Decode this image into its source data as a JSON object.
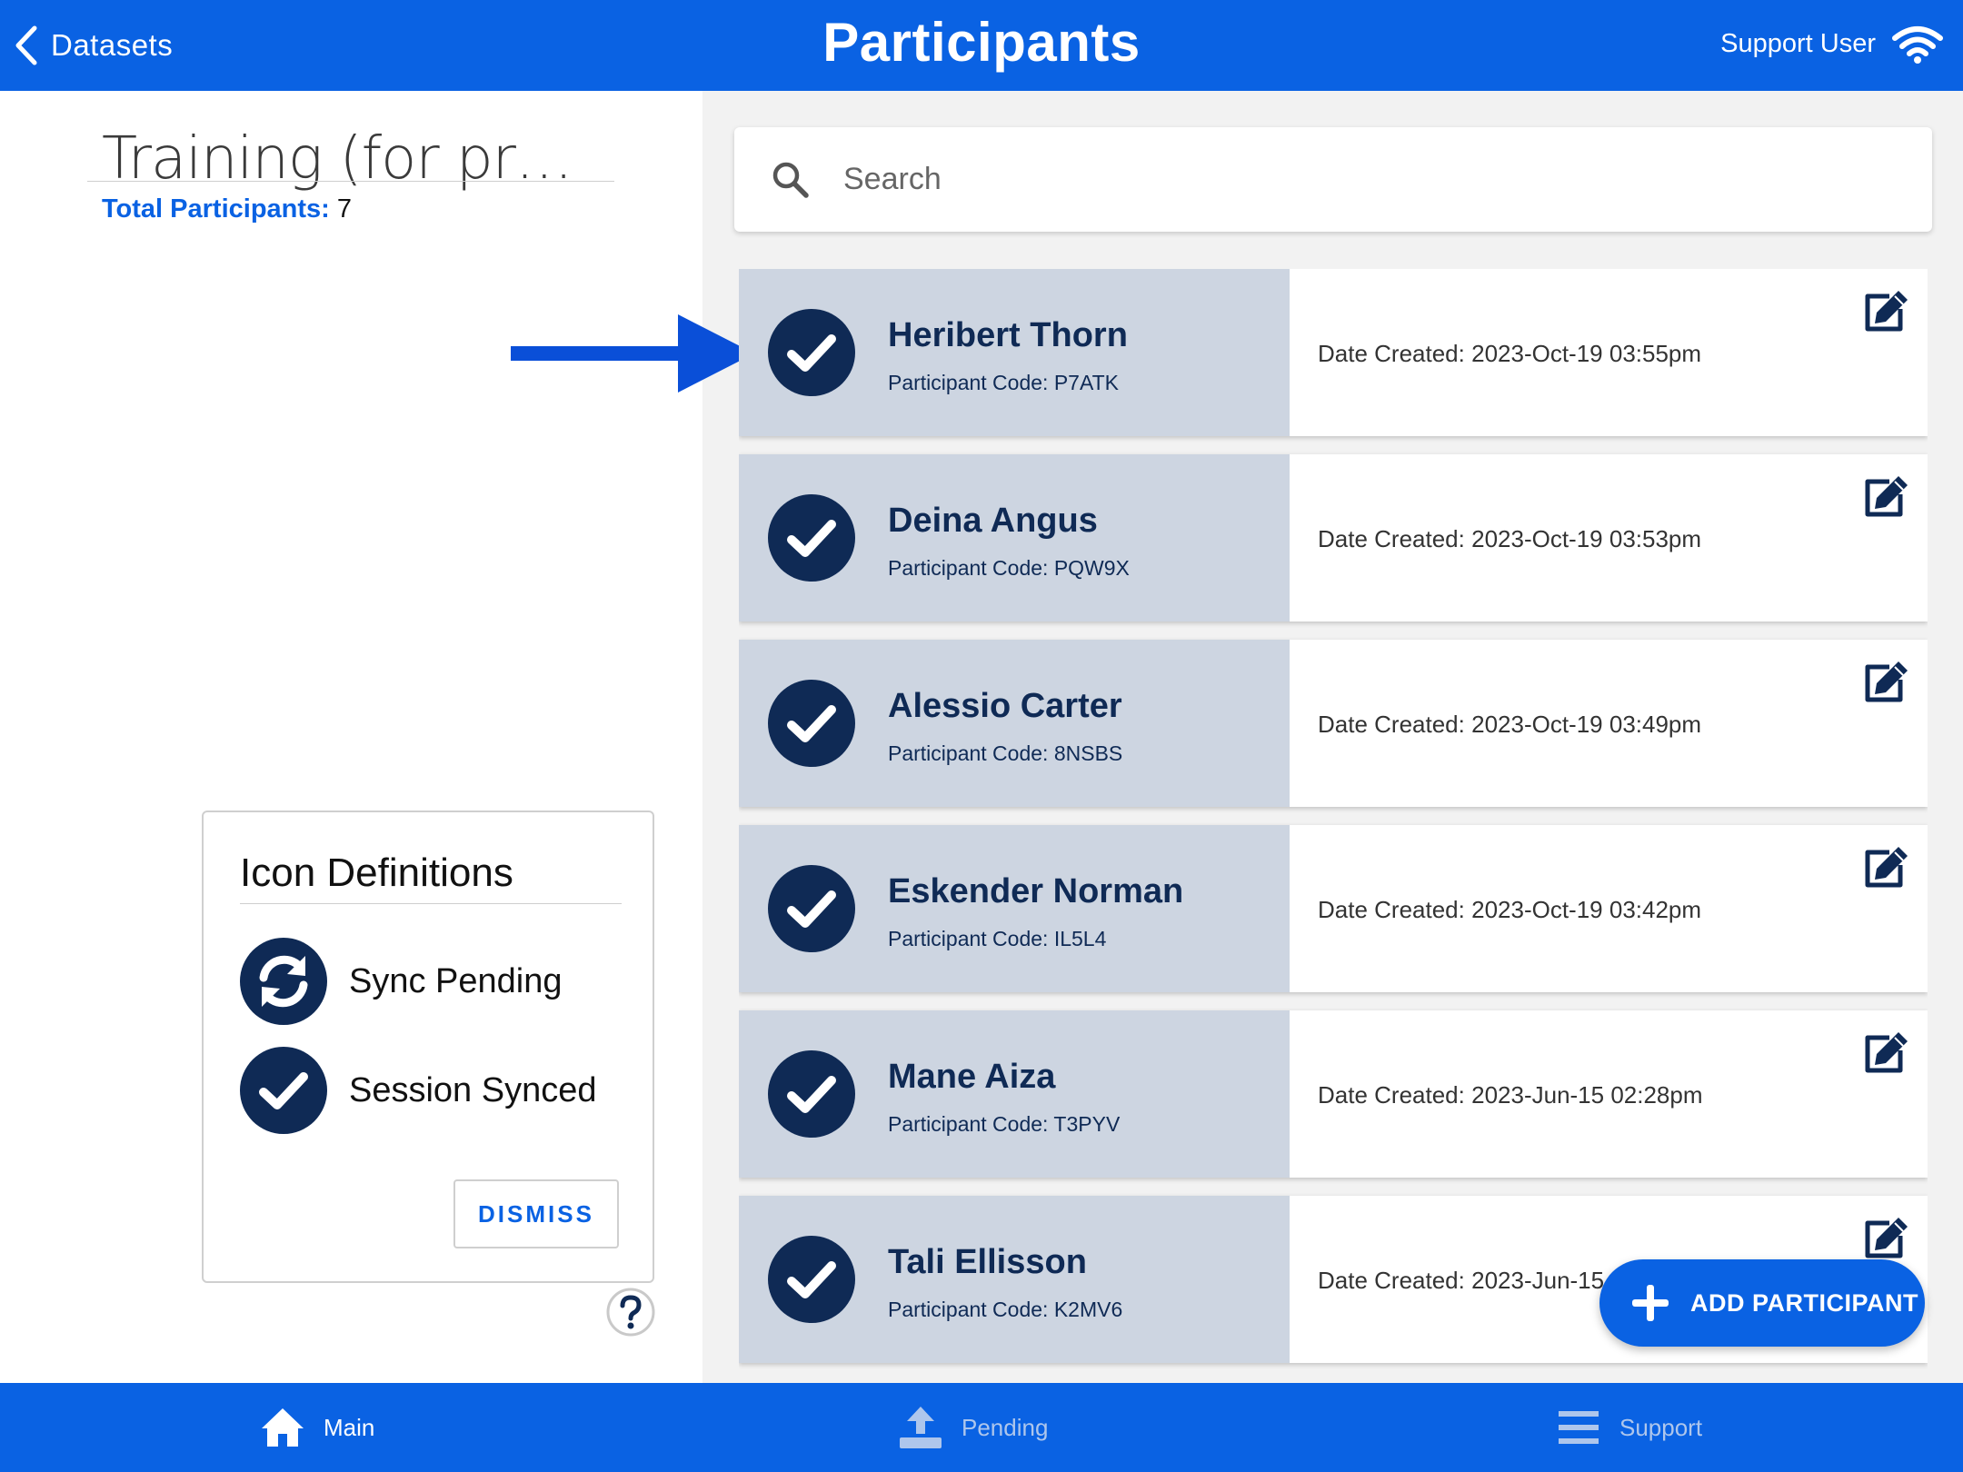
{
  "header": {
    "back_label": "Datasets",
    "title": "Participants",
    "user": "Support User",
    "connection_icon": "wifi-icon"
  },
  "sidebar": {
    "dataset_title": "Training (for practice)",
    "total_label": "Total Participants:",
    "total_value": "7",
    "icon_definitions": {
      "title": "Icon Definitions",
      "items": [
        {
          "icon": "sync-icon",
          "label": "Sync Pending"
        },
        {
          "icon": "check-icon",
          "label": "Session Synced"
        }
      ],
      "dismiss_label": "DISMISS"
    },
    "help_icon": "question-icon"
  },
  "search": {
    "placeholder": "Search",
    "value": ""
  },
  "participants": [
    {
      "name": "Heribert Thorn",
      "code_label": "Participant Code:",
      "code": "P7ATK",
      "date_label": "Date Created:",
      "date": "2023-Oct-19 03:55pm",
      "status": "Session Synced"
    },
    {
      "name": "Deina Angus",
      "code_label": "Participant Code:",
      "code": "PQW9X",
      "date_label": "Date Created:",
      "date": "2023-Oct-19 03:53pm",
      "status": "Session Synced"
    },
    {
      "name": "Alessio Carter",
      "code_label": "Participant Code:",
      "code": "8NSBS",
      "date_label": "Date Created:",
      "date": "2023-Oct-19 03:49pm",
      "status": "Session Synced"
    },
    {
      "name": "Eskender Norman",
      "code_label": "Participant Code:",
      "code": "IL5L4",
      "date_label": "Date Created:",
      "date": "2023-Oct-19 03:42pm",
      "status": "Session Synced"
    },
    {
      "name": "Mane Aiza",
      "code_label": "Participant Code:",
      "code": "T3PYV",
      "date_label": "Date Created:",
      "date": "2023-Jun-15 02:28pm",
      "status": "Session Synced"
    },
    {
      "name": "Tali Ellisson",
      "code_label": "Participant Code:",
      "code": "K2MV6",
      "date_label": "Date Created:",
      "date": "2023-Jun-15",
      "status": "Session Synced"
    }
  ],
  "fab": {
    "label": "ADD PARTICIPANT",
    "icon": "plus-icon"
  },
  "bottom_nav": [
    {
      "label": "Main",
      "icon": "home-icon",
      "active": true
    },
    {
      "label": "Pending",
      "icon": "upload-icon",
      "active": false
    },
    {
      "label": "Support",
      "icon": "menu-icon",
      "active": false
    }
  ],
  "colors": {
    "brand_blue": "#0a62e3",
    "navy": "#0f2a55",
    "row_left_bg": "#cdd5e1",
    "nav_inactive": "#aec6ec"
  }
}
